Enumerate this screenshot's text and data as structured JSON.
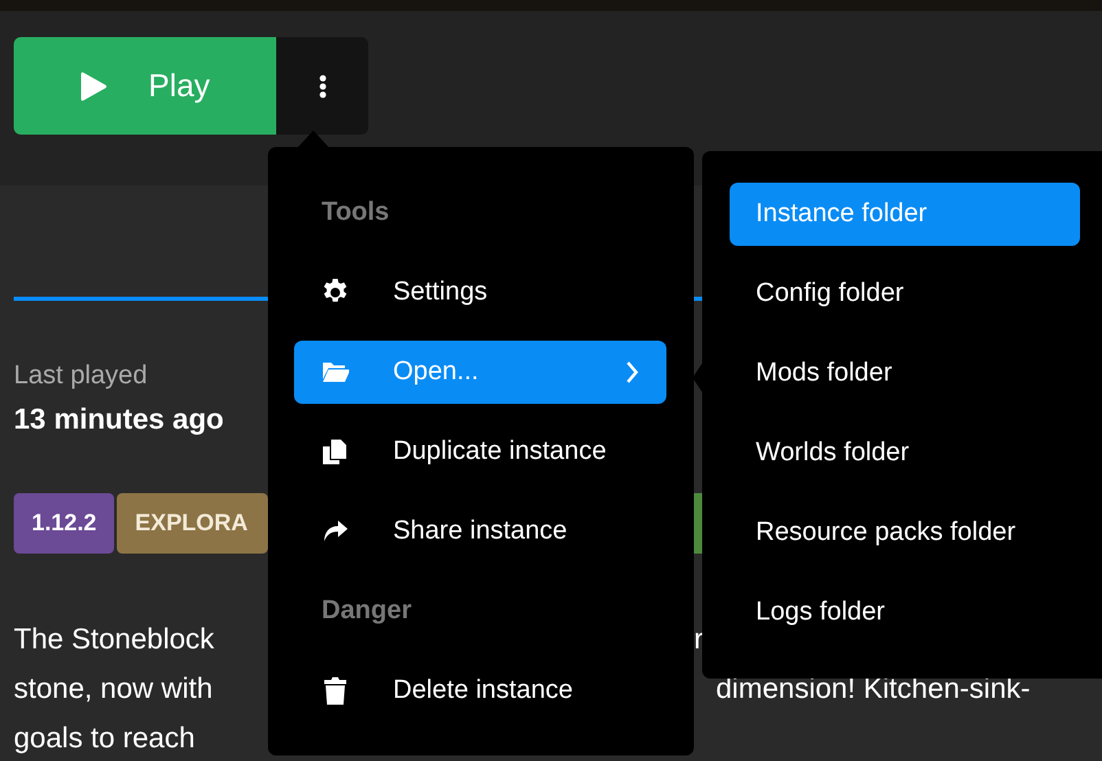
{
  "play_button": {
    "label": "Play"
  },
  "menu": {
    "sections": [
      {
        "heading": "Tools",
        "items": [
          {
            "label": "Settings",
            "selected": false,
            "has_submenu": false
          },
          {
            "label": "Open...",
            "selected": true,
            "has_submenu": true
          },
          {
            "label": "Duplicate instance",
            "selected": false,
            "has_submenu": false
          },
          {
            "label": "Share instance",
            "selected": false,
            "has_submenu": false
          }
        ]
      },
      {
        "heading": "Danger",
        "items": [
          {
            "label": "Delete instance",
            "selected": false,
            "has_submenu": false
          }
        ]
      }
    ]
  },
  "submenu": {
    "items": [
      {
        "label": "Instance folder",
        "selected": true
      },
      {
        "label": "Config folder",
        "selected": false
      },
      {
        "label": "Mods folder",
        "selected": false
      },
      {
        "label": "Worlds folder",
        "selected": false
      },
      {
        "label": "Resource packs folder",
        "selected": false
      },
      {
        "label": "Logs folder",
        "selected": false
      }
    ]
  },
  "details": {
    "last_played_label": "Last played",
    "last_played_value": "13 minutes ago",
    "tags": [
      {
        "label": "1.12.2",
        "color": "#6b4a96"
      },
      {
        "label": "EXPLORA",
        "color": "#8c7446"
      },
      {
        "color": "#4e8a3e"
      }
    ],
    "description_lines": [
      {
        "left": "The Stoneblock",
        "right": "r"
      },
      {
        "left": "stone, now with",
        "right": "dimension! Kitchen-sink-"
      },
      {
        "left": "goals to reach"
      }
    ]
  }
}
